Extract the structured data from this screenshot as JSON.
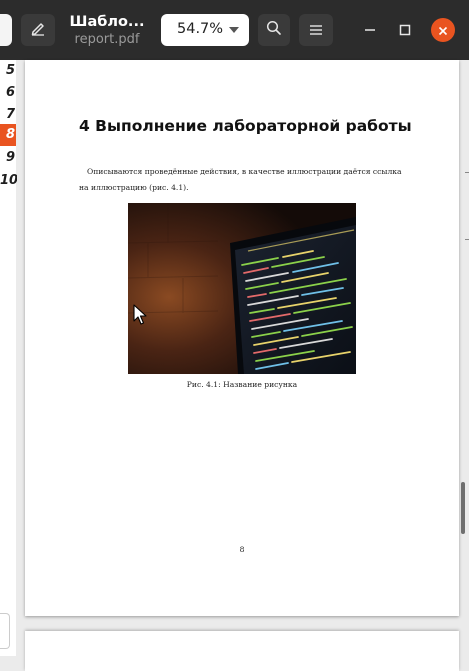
{
  "header": {
    "title": "Шабло...",
    "subtitle": "report.pdf",
    "zoom": "54.7%",
    "icons": {
      "annotate": "pencil-icon",
      "search": "search-icon",
      "menu": "hamburger-menu-icon",
      "minimize": "minimize-icon",
      "maximize": "maximize-icon",
      "close": "close-icon"
    },
    "accent": "#e95420"
  },
  "sidebar": {
    "items": [
      {
        "label": "5"
      },
      {
        "label": "6"
      },
      {
        "label": "7"
      },
      {
        "label": "8",
        "active": true
      },
      {
        "label": "9"
      },
      {
        "label": "10"
      }
    ]
  },
  "page": {
    "heading": "4  Выполнение лабораторной работы",
    "paragraph": "Описываются проведённые действия, в качестве иллюстрации даётся ссылка на иллюстрацию (рис. 4.1).",
    "caption": "Рис. 4.1: Название рисунка",
    "page_number": "8"
  }
}
